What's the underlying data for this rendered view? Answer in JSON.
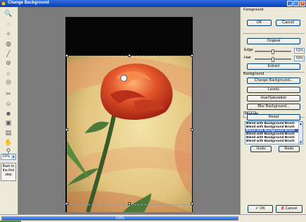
{
  "window": {
    "title": "Change Background",
    "minimize": "_",
    "maximize": "□",
    "close": "✕"
  },
  "toolbar": {
    "tools": [
      {
        "name": "zoom-tool-icon",
        "glyph": "🔍"
      },
      {
        "name": "lasso-select-icon",
        "glyph": "◌"
      },
      {
        "name": "magic-wand-icon",
        "glyph": "✧"
      },
      {
        "name": "brush-select-icon",
        "glyph": "◍"
      },
      {
        "name": "line-tool-icon",
        "glyph": "╱"
      },
      {
        "name": "stamp-tool-icon",
        "glyph": "⊛"
      },
      {
        "name": "circle-tool-icon",
        "glyph": "○"
      },
      {
        "name": "gradient-tool-icon",
        "glyph": "◎"
      },
      {
        "name": "scissors-icon",
        "glyph": "✂"
      },
      {
        "name": "person-cut-icon",
        "glyph": "☺"
      },
      {
        "name": "eraser-person-icon",
        "glyph": "☻"
      },
      {
        "name": "blend-icon",
        "glyph": "▣"
      },
      {
        "name": "landscape-icon",
        "glyph": "▤"
      },
      {
        "name": "hand-tool-icon",
        "glyph": "✋"
      },
      {
        "name": "magnifier-icon",
        "glyph": "⚲"
      }
    ],
    "zoom_value": "15%",
    "back_first_label": "Back to the first step"
  },
  "panel": {
    "foreground_title": "Foreground",
    "ok_label": "OK",
    "cancel_label": "Cancel",
    "original_label": "Original",
    "edge_label": "Edge",
    "edge_value": "51%",
    "edge_level": 0.51,
    "hair_label": "Hair",
    "hair_value": "50%",
    "hair_level": 0.5,
    "extract_label": "Extract",
    "background_title": "Background",
    "change_background_label": "Change Background...",
    "levels_label": "Levels",
    "hue_saturation_label": "Hue/Saturation",
    "blur_background_label": "Blur Background...",
    "history_title": "History",
    "reset_label": "Reset",
    "history_items": [
      "Blend with Background Brush",
      "Blend with Background Brush",
      "Blend with Background Brush",
      "Blend with Background Brush",
      "Blend with Background Brush",
      "Blend with Background Brush"
    ],
    "history_selected_index": 2,
    "undo_label": "Undo",
    "redo_label": "Redo",
    "final_ok_label": "OK",
    "final_cancel_label": "Cancel"
  },
  "status": {
    "progress_text": "100%",
    "progress": 1.0
  },
  "colors": {
    "title_bar": "#0a3fb5",
    "selection": "#3163c5",
    "rose": "#d8402a",
    "ok_check": "#2a9a2a",
    "cancel_x": "#c8241a"
  }
}
